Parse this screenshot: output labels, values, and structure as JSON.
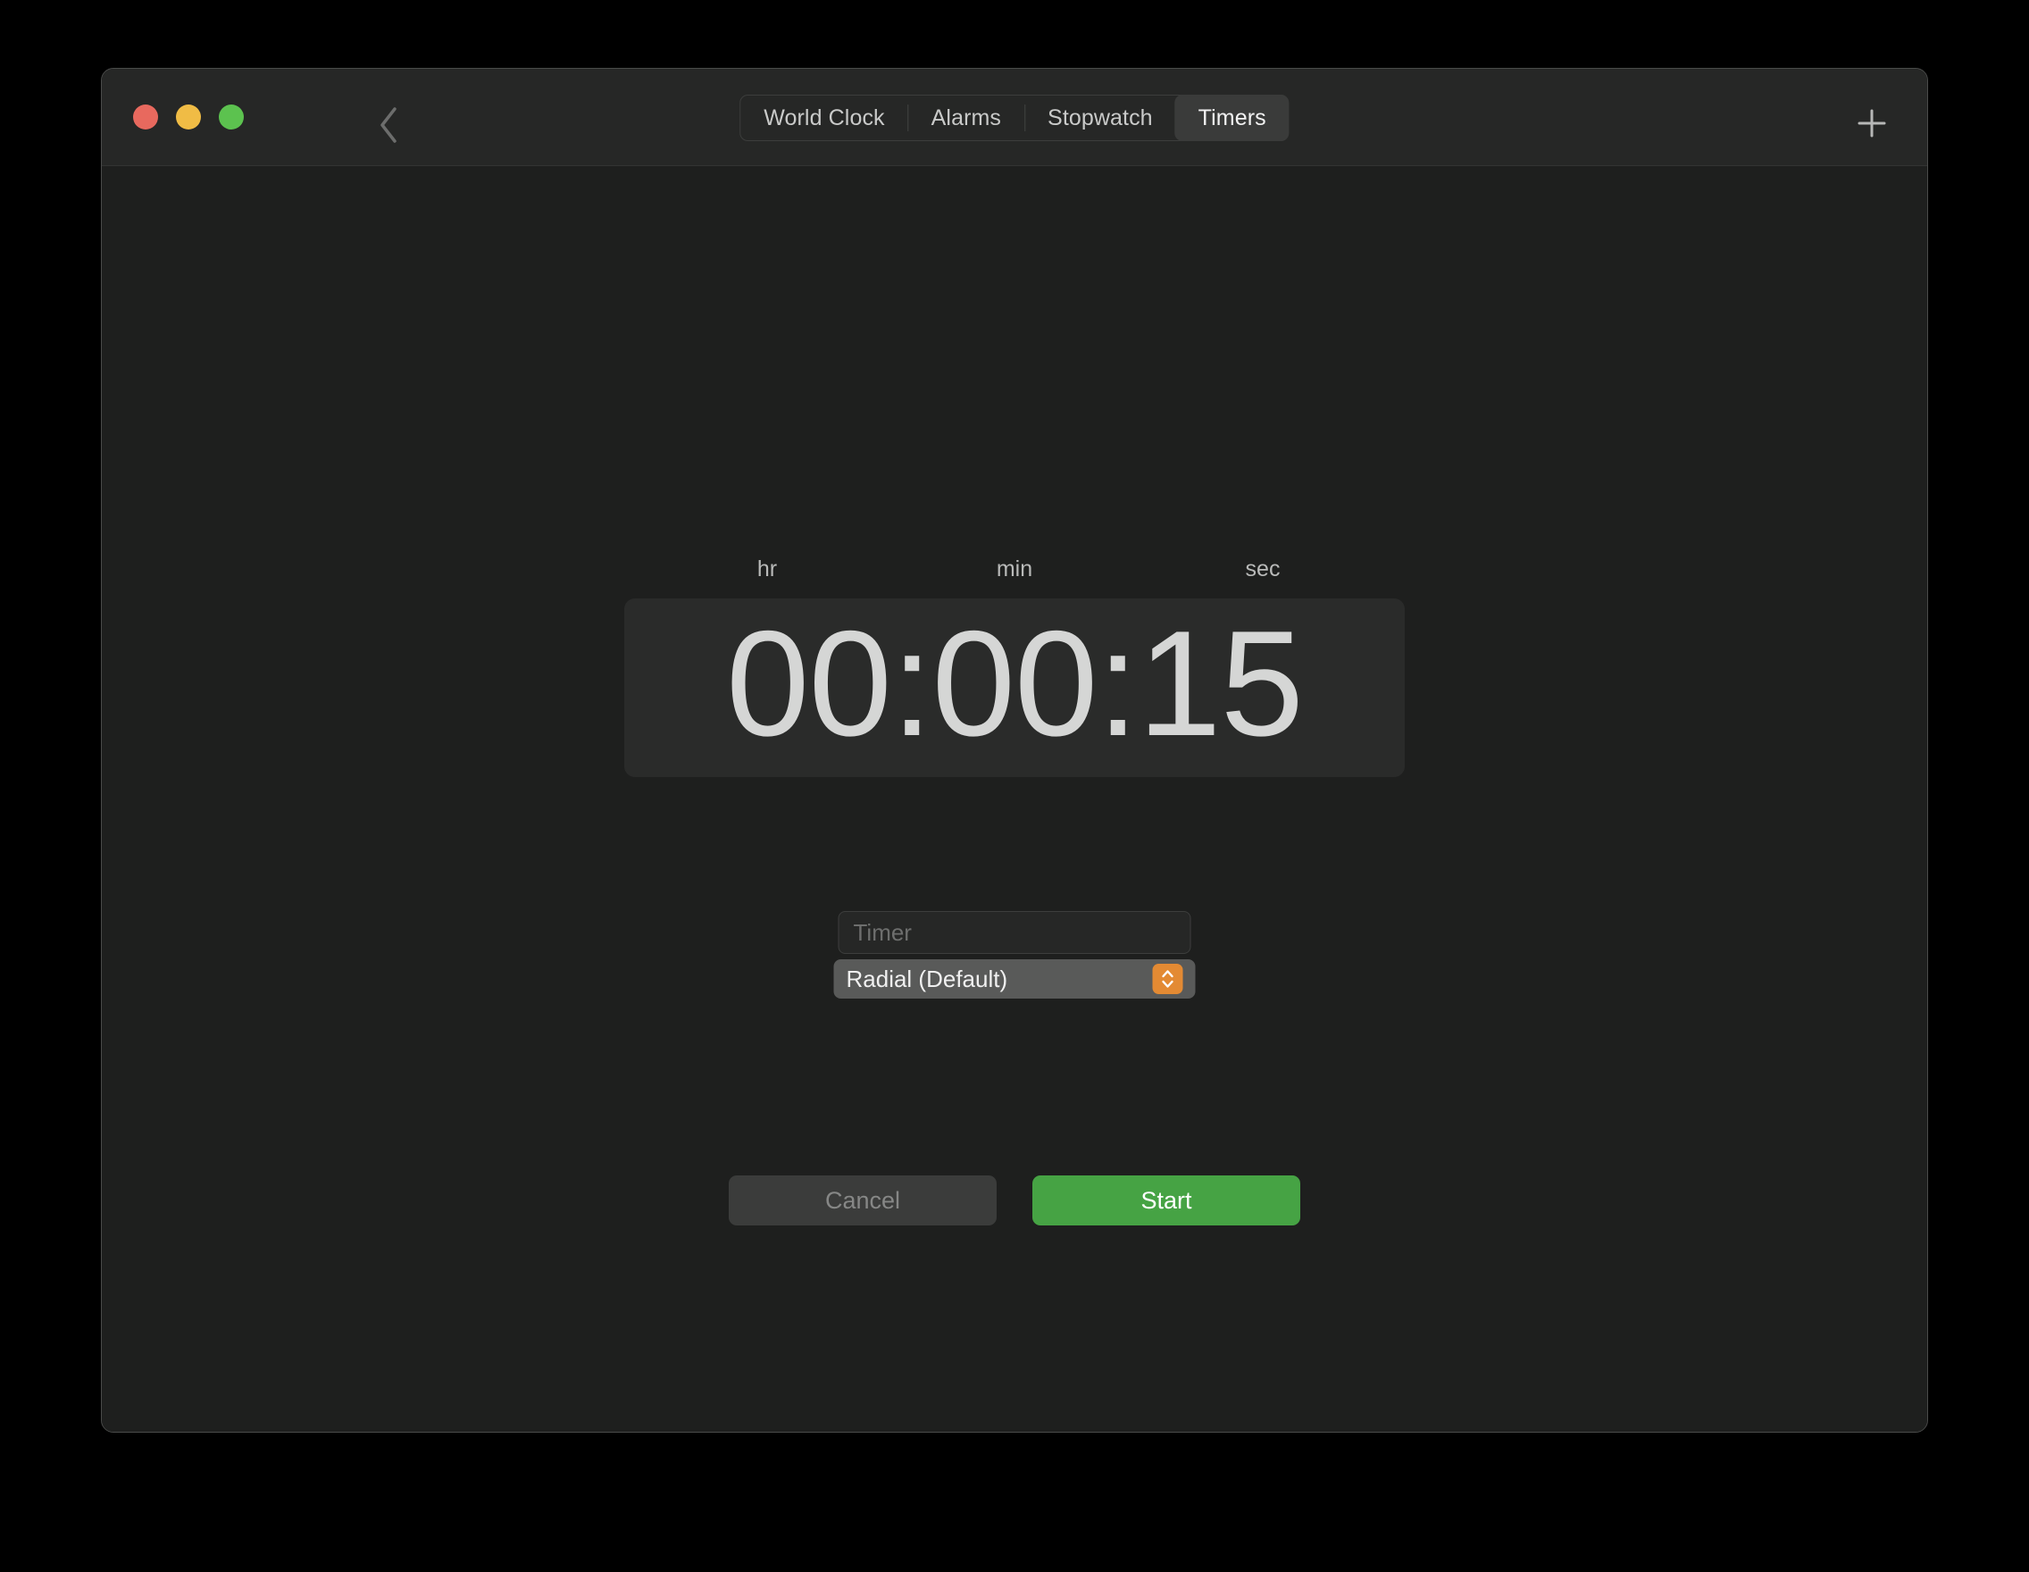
{
  "window": {
    "traffic_lights": [
      {
        "name": "close",
        "color": "#e8695e"
      },
      {
        "name": "minimize",
        "color": "#f0bc45"
      },
      {
        "name": "maximize",
        "color": "#5cc24f"
      }
    ],
    "back_icon": "chevron-left-icon",
    "add_icon": "plus-icon"
  },
  "tabs": [
    {
      "label": "World Clock",
      "selected": false
    },
    {
      "label": "Alarms",
      "selected": false
    },
    {
      "label": "Stopwatch",
      "selected": false
    },
    {
      "label": "Timers",
      "selected": true
    }
  ],
  "timer": {
    "units": {
      "hours": "hr",
      "minutes": "min",
      "seconds": "sec"
    },
    "value": "00:00:15",
    "hours": "00",
    "minutes": "00",
    "seconds": "15"
  },
  "name_field": {
    "value": "",
    "placeholder": "Timer"
  },
  "style_select": {
    "selected": "Radial (Default)",
    "stepper_icon": "chevron-up-down-icon",
    "accent_color": "#e38a33"
  },
  "actions": {
    "cancel_label": "Cancel",
    "start_label": "Start",
    "start_color": "#46a344"
  }
}
